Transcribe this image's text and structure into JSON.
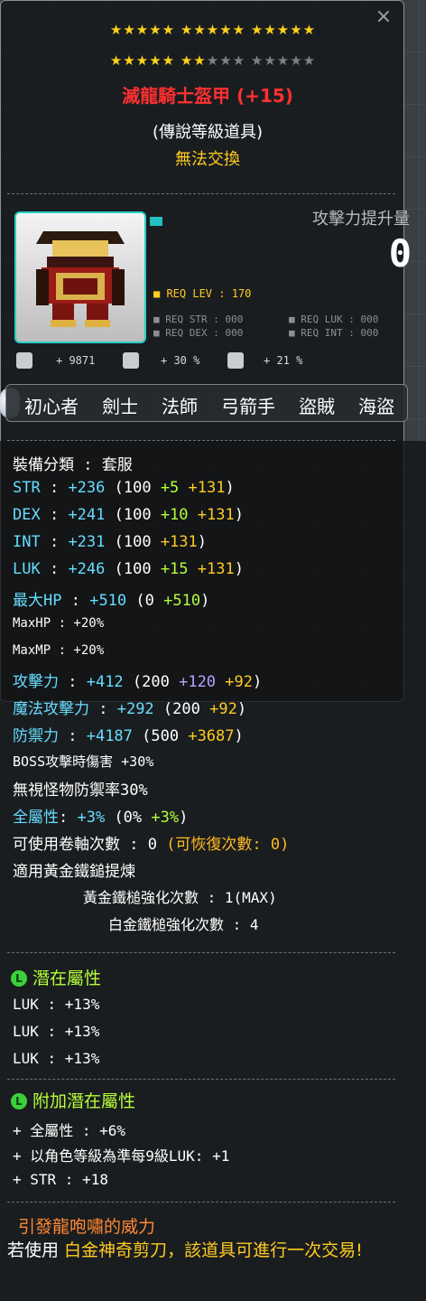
{
  "item": {
    "stars_row1": "★★★★★ ★★★★★ ★★★★★",
    "stars_row2_on": "★★★★★ ★★",
    "stars_row2_off": "★★★ ★★★★★",
    "name": "滅龍騎士盔甲 (+15)",
    "grade": "(傳說等級道具)",
    "trade": "無法交換",
    "icon": "dragon-knight-armor-icon"
  },
  "attack_increase": {
    "label": "攻擊力提升量",
    "value": "0"
  },
  "requirements": {
    "lev": "■ REQ LEV : 170",
    "str": "■ REQ STR : 000",
    "luk": "■ REQ LUK : 000",
    "dex": "■ REQ DEX : 000",
    "int": "■ REQ INT : 000"
  },
  "mini_stats": {
    "first": "+ 9871",
    "second": "+ 30 %",
    "third": "+ 21 %"
  },
  "jobs": [
    "初心者",
    "劍士",
    "法師",
    "弓箭手",
    "盜賊",
    "海盜"
  ],
  "stats": {
    "category": "裝備分類 : 套服",
    "str": [
      "STR",
      " : ",
      "+236",
      " (100 ",
      "+5",
      " ",
      "+131",
      ")"
    ],
    "dex": [
      "DEX",
      " : ",
      "+241",
      " (100 ",
      "+10",
      " ",
      "+131",
      ")"
    ],
    "int": [
      "INT",
      " : ",
      "+231",
      " (100 ",
      "+131",
      ")"
    ],
    "luk": [
      "LUK",
      " : ",
      "+246",
      " (100 ",
      "+15",
      " ",
      "+131",
      ")"
    ],
    "maxhp_line": [
      "最大HP",
      " : ",
      "+510",
      " (0 ",
      "+510",
      ")"
    ],
    "maxhp_pct": "MaxHP : +20%",
    "maxmp_pct": "MaxMP : +20%",
    "atk": [
      "攻擊力",
      " : ",
      "+412",
      " (200 ",
      "+120",
      " ",
      "+92",
      ")"
    ],
    "matk": [
      "魔法攻擊力",
      " : ",
      "+292",
      " (200 ",
      "+92",
      ")"
    ],
    "def": [
      "防禦力",
      " : ",
      "+4187",
      " (500 ",
      "+3687",
      ")"
    ],
    "boss": "BOSS攻擊時傷害 +30%",
    "ignore_def": "無視怪物防禦率30%",
    "all_stat": [
      "全屬性",
      ": ",
      "+3%",
      " (0% ",
      "+3%",
      ")"
    ],
    "scroll": [
      "可使用卷軸次數 : 0 ",
      "(可恢復次數: 0)"
    ],
    "golden_hammer": "適用黃金鐵鎚提煉",
    "golden_hammer_count": "黃金鐵槌強化次數 : 1(MAX)",
    "platinum_hammer_count": "白金鐵槌強化次數 : 4"
  },
  "potential": {
    "title": "潛在屬性",
    "badge": "L",
    "lines": [
      "LUK : +13%",
      "LUK : +13%",
      "LUK : +13%"
    ]
  },
  "bonus_potential": {
    "title": "附加潛在屬性",
    "badge": "L",
    "lines": [
      "+ 全屬性 : +6%",
      "+ 以角色等級為準每9級LUK: +1",
      "+ STR : +18"
    ]
  },
  "footer": {
    "orange": "引發龍咆嘯的威力",
    "text_prefix": "若使用 ",
    "text_highlight": "白金神奇剪刀",
    "text_suffix": "，該道具可進行一次交易!"
  },
  "colors": {
    "name": "#ff3030",
    "trade": "#ffcc22",
    "stat_label": "#66ddff",
    "bonus": "#b6ff3a",
    "flame": "#ffcc22",
    "star_gold": "#ffd21a"
  }
}
